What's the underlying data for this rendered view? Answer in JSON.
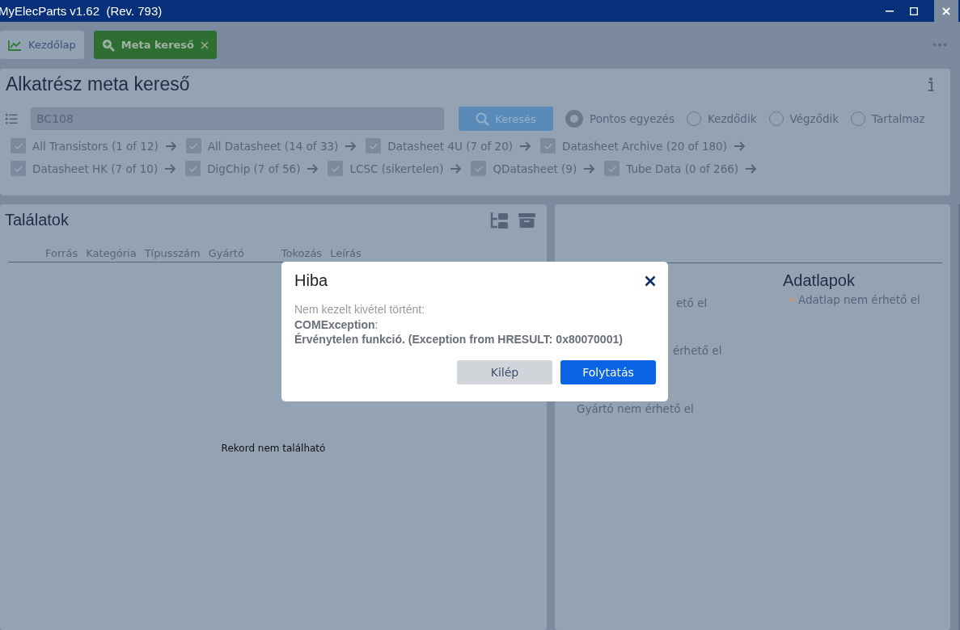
{
  "window": {
    "title": "MyElecParts v1.62  (Rev. 793)"
  },
  "tabs": [
    {
      "label": "Kezdőlap",
      "selected": false,
      "closable": false
    },
    {
      "label": "Meta kereső",
      "selected": true,
      "closable": true
    }
  ],
  "search_panel": {
    "title": "Alkatrész meta kereső",
    "search_value": "BC108",
    "search_button": "Keresés",
    "match_modes": [
      {
        "label": "Pontos egyezés",
        "selected": true
      },
      {
        "label": "Kezdődik",
        "selected": false
      },
      {
        "label": "Végződik",
        "selected": false
      },
      {
        "label": "Tartalmaz",
        "selected": false
      }
    ],
    "sources": [
      [
        {
          "label": "All Transistors (1 of 12)",
          "checked": true
        },
        {
          "label": "All Datasheet (14 of 33)",
          "checked": true
        },
        {
          "label": "Datasheet 4U (7 of 20)",
          "checked": true
        },
        {
          "label": "Datasheet Archive (20 of 180)",
          "checked": true
        }
      ],
      [
        {
          "label": "Datasheet HK (7 of 10)",
          "checked": true
        },
        {
          "label": "DigChip (7 of 56)",
          "checked": true
        },
        {
          "label": "LCSC (sikertelen)",
          "checked": true
        },
        {
          "label": "QDatasheet (9)",
          "checked": true
        },
        {
          "label": "Tube Data (0 of 266)",
          "checked": true
        }
      ]
    ]
  },
  "results": {
    "title": "Találatok",
    "columns": [
      "Forrás",
      "Kategória",
      "Típusszám",
      "Gyártó",
      "Tokozás",
      "Leírás"
    ],
    "empty_message": "Rekord nem található"
  },
  "details": {
    "column_1": [
      "ető el",
      "érhető el",
      "Gyártó nem érhető el"
    ],
    "datasheets_title": "Adatlapok",
    "datasheets": [
      "Adatlap nem érhető el"
    ]
  },
  "dialog": {
    "title": "Hiba",
    "intro": "Nem kezelt kivétel történt:",
    "exception": "**COMException**:",
    "message": "Érvénytelen funkció. (Exception from HRESULT: 0x80070001)",
    "buttons": [
      {
        "label": "Kilép",
        "kind": "secondary"
      },
      {
        "label": "Folytatás",
        "kind": "primary"
      }
    ]
  }
}
